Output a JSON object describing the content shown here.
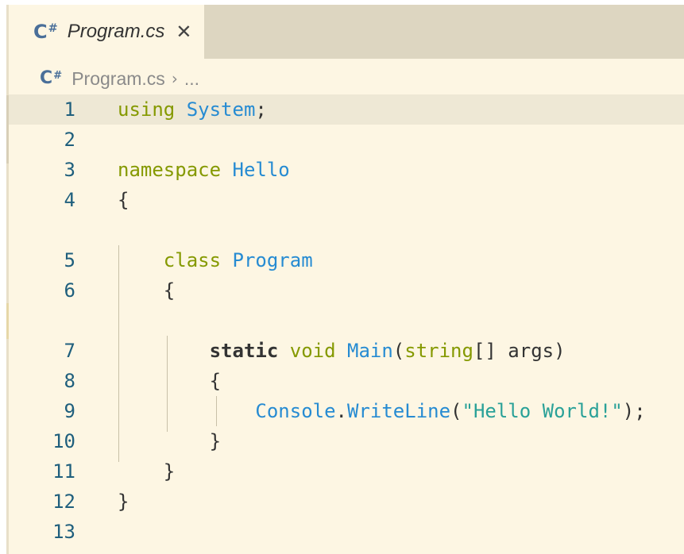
{
  "tab": {
    "label": "Program.cs",
    "icon": "csharp-file-icon",
    "close": "✕"
  },
  "breadcrumb": {
    "file": "Program.cs",
    "separator": "›",
    "rest": "..."
  },
  "icon_text": {
    "c": "C",
    "hash": "#"
  },
  "lines": [
    {
      "n": "1",
      "tokens": [
        {
          "t": "using",
          "c": "kw"
        },
        {
          "t": " ",
          "c": "plain"
        },
        {
          "t": "System",
          "c": "ty"
        },
        {
          "t": ";",
          "c": "plain"
        }
      ]
    },
    {
      "n": "2",
      "tokens": []
    },
    {
      "n": "3",
      "tokens": [
        {
          "t": "namespace",
          "c": "kw"
        },
        {
          "t": " ",
          "c": "plain"
        },
        {
          "t": "Hello",
          "c": "ty"
        }
      ]
    },
    {
      "n": "4",
      "tokens": [
        {
          "t": "{",
          "c": "plain"
        }
      ]
    },
    {
      "n": "5",
      "tokens": [
        {
          "t": "    ",
          "c": "plain"
        },
        {
          "t": "class",
          "c": "kw"
        },
        {
          "t": " ",
          "c": "plain"
        },
        {
          "t": "Program",
          "c": "ty"
        }
      ]
    },
    {
      "n": "6",
      "tokens": [
        {
          "t": "    {",
          "c": "plain"
        }
      ]
    },
    {
      "n": "7",
      "tokens": [
        {
          "t": "        ",
          "c": "plain"
        },
        {
          "t": "static",
          "c": "bold"
        },
        {
          "t": " ",
          "c": "plain"
        },
        {
          "t": "void",
          "c": "kw"
        },
        {
          "t": " ",
          "c": "plain"
        },
        {
          "t": "Main",
          "c": "ty"
        },
        {
          "t": "(",
          "c": "plain"
        },
        {
          "t": "string",
          "c": "kw"
        },
        {
          "t": "[] args)",
          "c": "plain"
        }
      ]
    },
    {
      "n": "8",
      "tokens": [
        {
          "t": "        {",
          "c": "plain"
        }
      ]
    },
    {
      "n": "9",
      "tokens": [
        {
          "t": "            ",
          "c": "plain"
        },
        {
          "t": "Console",
          "c": "ty"
        },
        {
          "t": ".",
          "c": "plain"
        },
        {
          "t": "WriteLine",
          "c": "ty"
        },
        {
          "t": "(",
          "c": "plain"
        },
        {
          "t": "\"Hello World!\"",
          "c": "str"
        },
        {
          "t": ");",
          "c": "plain"
        }
      ]
    },
    {
      "n": "10",
      "tokens": [
        {
          "t": "        }",
          "c": "plain"
        }
      ]
    },
    {
      "n": "11",
      "tokens": [
        {
          "t": "    }",
          "c": "plain"
        }
      ]
    },
    {
      "n": "12",
      "tokens": [
        {
          "t": "}",
          "c": "plain"
        }
      ]
    },
    {
      "n": "13",
      "tokens": []
    }
  ]
}
